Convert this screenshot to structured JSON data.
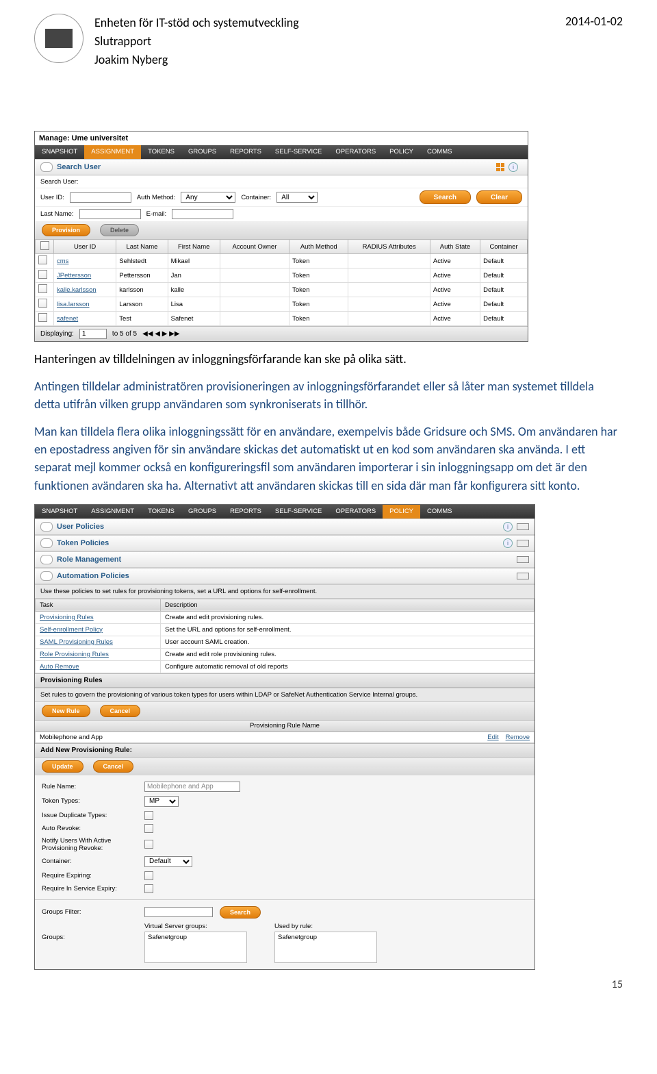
{
  "header": {
    "org_line": "Enheten för IT-stöd och systemutveckling",
    "doc_type": "Slutrapport",
    "author": "Joakim Nyberg",
    "date": "2014-01-02"
  },
  "app1": {
    "manage_label": "Manage: Ume universitet",
    "tabs": [
      "SNAPSHOT",
      "ASSIGNMENT",
      "TOKENS",
      "GROUPS",
      "REPORTS",
      "SELF-SERVICE",
      "OPERATORS",
      "POLICY",
      "COMMS"
    ],
    "active_tab_index": 1,
    "section_title": "Search User",
    "search_user_label": "Search User:",
    "user_id_label": "User ID:",
    "auth_method_label": "Auth Method:",
    "auth_method_value": "Any",
    "container_label": "Container:",
    "container_value": "All",
    "last_name_label": "Last Name:",
    "email_label": "E-mail:",
    "search_btn": "Search",
    "clear_btn": "Clear",
    "provision_btn": "Provision",
    "delete_btn": "Delete",
    "columns": [
      "",
      "User ID",
      "Last Name",
      "First Name",
      "Account Owner",
      "Auth Method",
      "RADIUS Attributes",
      "Auth State",
      "Container"
    ],
    "rows": [
      {
        "id": "cms",
        "last": "Sehlstedt",
        "first": "Mikael",
        "auth": "Token",
        "state": "Active",
        "cont": "Default"
      },
      {
        "id": "JPettersson",
        "last": "Pettersson",
        "first": "Jan",
        "auth": "Token",
        "state": "Active",
        "cont": "Default"
      },
      {
        "id": "kalle.karlsson",
        "last": "karlsson",
        "first": "kalle",
        "auth": "Token",
        "state": "Active",
        "cont": "Default"
      },
      {
        "id": "lisa.larsson",
        "last": "Larsson",
        "first": "Lisa",
        "auth": "Token",
        "state": "Active",
        "cont": "Default"
      },
      {
        "id": "safenet",
        "last": "Test",
        "first": "Safenet",
        "auth": "Token",
        "state": "Active",
        "cont": "Default"
      }
    ],
    "pager": {
      "displaying": "Displaying:",
      "from": "1",
      "range": "to 5 of 5",
      "arrows": "◀◀ ◀ ▶ ▶▶"
    }
  },
  "text": {
    "p1": "Hanteringen av tilldelningen av inloggningsförfarande kan ske på olika sätt.",
    "p2": "Antingen tilldelar administratören provisioneringen av inloggningsförfarandet eller så låter man systemet tilldela detta utifrån vilken grupp användaren som synkroniserats in tillhör.",
    "p3": "Man kan tilldela flera olika inloggningssätt för en användare, exempelvis både Gridsure och SMS. Om användaren har en epostadress angiven för sin användare skickas det automatiskt ut en kod som användaren ska använda. I ett separat mejl kommer också en konfigureringsfil som användaren importerar i sin inloggningsapp om det är den funktionen avändaren ska ha. Alternativt att användaren skickas till en sida där man får konfigurera sitt konto."
  },
  "app2": {
    "tabs": [
      "SNAPSHOT",
      "ASSIGNMENT",
      "TOKENS",
      "GROUPS",
      "REPORTS",
      "SELF-SERVICE",
      "OPERATORS",
      "POLICY",
      "COMMS"
    ],
    "active_tab_index": 7,
    "sections": {
      "user_policies": "User Policies",
      "token_policies": "Token Policies",
      "role_mgmt": "Role Management",
      "automation": "Automation Policies"
    },
    "automation_desc": "Use these policies to set rules for provisioning tokens, set a URL and options for self-enrollment.",
    "task_cols": [
      "Task",
      "Description"
    ],
    "tasks": [
      {
        "t": "Provisioning Rules",
        "d": "Create and edit provisioning rules."
      },
      {
        "t": "Self-enrollment Policy",
        "d": "Set the URL and options for self-enrollment."
      },
      {
        "t": "SAML Provisioning Rules",
        "d": "User account SAML creation."
      },
      {
        "t": "Role Provisioning Rules",
        "d": "Create and edit role provisioning rules."
      },
      {
        "t": "Auto Remove",
        "d": "Configure automatic removal of old reports"
      }
    ],
    "prov_rules_title": "Provisioning Rules",
    "prov_rules_desc": "Set rules to govern the provisioning of various token types for users within LDAP or SafeNet Authentication Service Internal groups.",
    "new_rule_btn": "New Rule",
    "cancel_btn": "Cancel",
    "col_rule_name": "Provisioning Rule Name",
    "rule_name": "Mobilephone and App",
    "edit": "Edit",
    "remove": "Remove",
    "add_rule_title": "Add New Provisioning Rule:",
    "update_btn": "Update",
    "form": {
      "rule_name_lab": "Rule Name:",
      "rule_name_val": "Mobilephone and App",
      "token_types_lab": "Token Types:",
      "token_types_val": "MP",
      "issue_dup_lab": "Issue Duplicate Types:",
      "auto_revoke_lab": "Auto Revoke:",
      "notify_lab": "Notify Users With Active Provisioning Revoke:",
      "container_lab": "Container:",
      "container_val": "Default",
      "req_expiring_lab": "Require Expiring:",
      "req_service_lab": "Require In Service Expiry:"
    },
    "groups_filter_lab": "Groups Filter:",
    "search_btn": "Search",
    "vs_groups_lab": "Virtual Server groups:",
    "used_by_lab": "Used by rule:",
    "groups_lab": "Groups:",
    "vs_group_item": "Safenetgroup",
    "used_group_item": "Safenetgroup"
  },
  "page_number": "15"
}
